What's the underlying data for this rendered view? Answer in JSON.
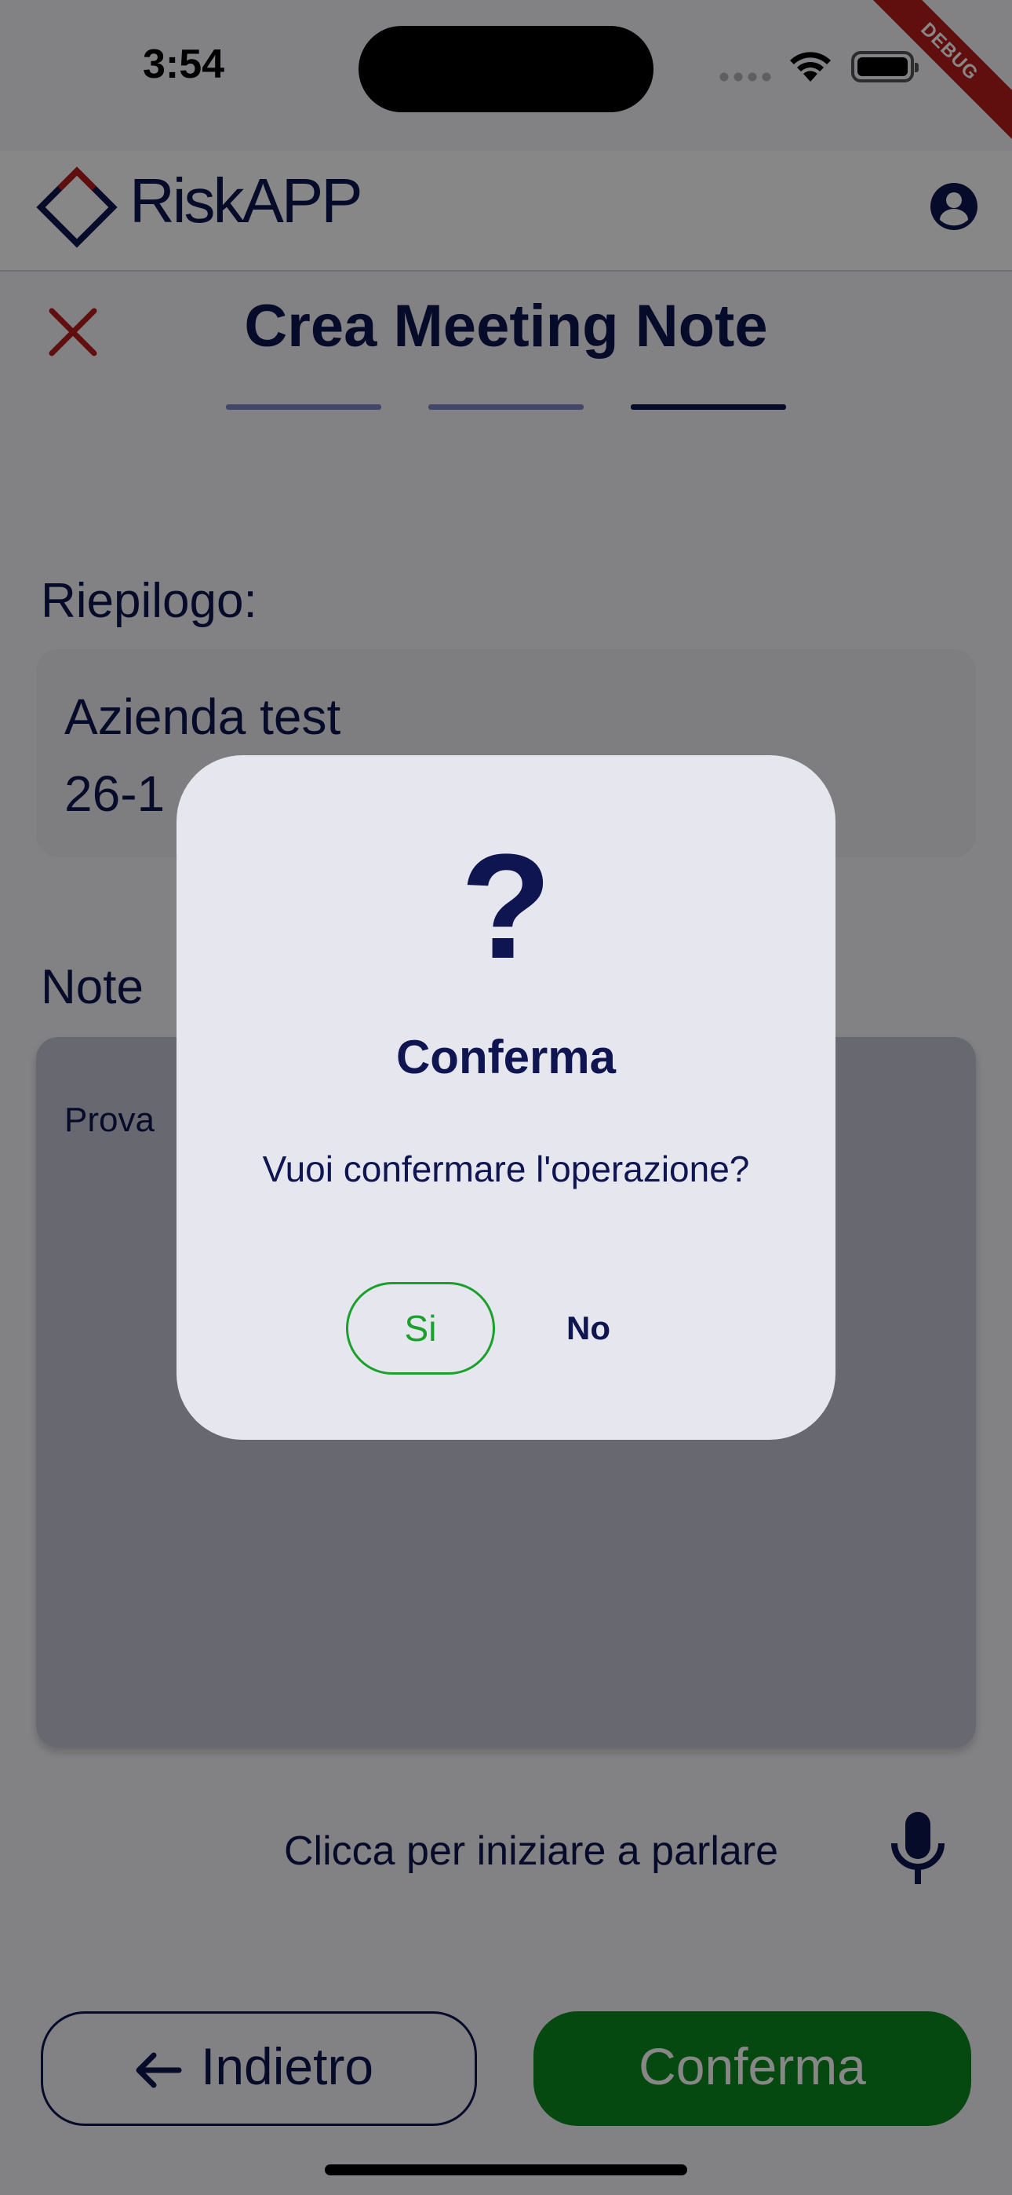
{
  "status_bar": {
    "time": "3:54",
    "debug_label": "DEBUG"
  },
  "app_bar": {
    "brand": "RiskAPP"
  },
  "header": {
    "title": "Crea Meeting Note",
    "steps_total": 3,
    "current_step": 3
  },
  "summary": {
    "label": "Riepilogo:",
    "company": "Azienda test",
    "date_partial": "26-1"
  },
  "notes": {
    "label": "Note",
    "value": "Prova"
  },
  "speech": {
    "hint": "Clicca per iniziare a parlare"
  },
  "footer": {
    "back_label": "Indietro",
    "confirm_label": "Conferma"
  },
  "dialog": {
    "icon": "question-mark",
    "icon_glyph": "?",
    "title": "Conferma",
    "message": "Vuoi confermare l'operazione?",
    "yes_label": "Si",
    "no_label": "No"
  },
  "colors": {
    "primary": "#0f1550",
    "success": "#1aa02b",
    "confirm_button": "#0c8a1f",
    "danger": "#b71c1c"
  }
}
